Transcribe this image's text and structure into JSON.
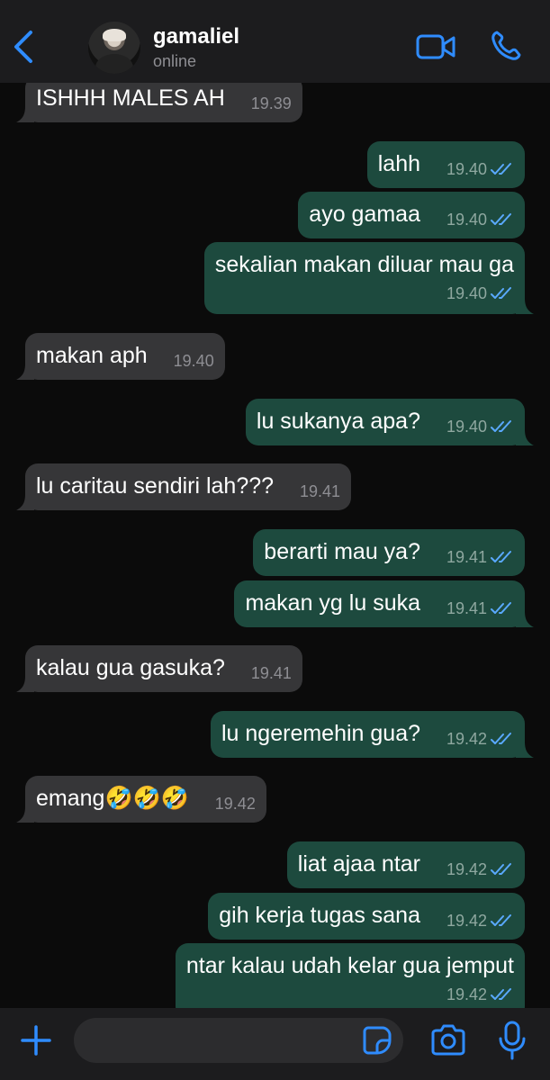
{
  "header": {
    "contact_name": "gamaliel",
    "status": "online",
    "icons": {
      "back": "chevron-left-icon",
      "video": "video-icon",
      "call": "phone-icon"
    }
  },
  "messages": [
    {
      "dir": "in",
      "text": "ISHHH MALES AH",
      "time": "19.39"
    },
    {
      "dir": "out",
      "text": "lahh",
      "time": "19.40"
    },
    {
      "dir": "out",
      "text": "ayo gamaa",
      "time": "19.40"
    },
    {
      "dir": "out",
      "text": "sekalian makan diluar mau ga",
      "time": "19.40"
    },
    {
      "dir": "in",
      "text": "makan aph",
      "time": "19.40"
    },
    {
      "dir": "out",
      "text": "lu sukanya apa?",
      "time": "19.40"
    },
    {
      "dir": "in",
      "text": "lu caritau sendiri lah???",
      "time": "19.41"
    },
    {
      "dir": "out",
      "text": "berarti mau ya?",
      "time": "19.41"
    },
    {
      "dir": "out",
      "text": "makan yg lu suka",
      "time": "19.41"
    },
    {
      "dir": "in",
      "text": "kalau gua gasuka?",
      "time": "19.41"
    },
    {
      "dir": "out",
      "text": "lu ngeremehin gua?",
      "time": "19.42"
    },
    {
      "dir": "in",
      "text": "emang🤣🤣🤣",
      "time": "19.42"
    },
    {
      "dir": "out",
      "text": "liat ajaa ntar",
      "time": "19.42"
    },
    {
      "dir": "out",
      "text": "gih kerja tugas sana",
      "time": "19.42"
    },
    {
      "dir": "out",
      "text": "ntar kalau udah kelar gua jemput",
      "time": "19.42"
    }
  ],
  "composer": {
    "placeholder": "",
    "icons": {
      "plus": "plus-icon",
      "sticker": "sticker-icon",
      "camera": "camera-icon",
      "mic": "microphone-icon"
    }
  },
  "colors": {
    "background": "#0b0b0b",
    "bar": "#1c1c1e",
    "incoming_bubble": "#363638",
    "outgoing_bubble": "#1d4a3e",
    "accent": "#2f8cff",
    "read_ticks": "#5aa9ff"
  }
}
